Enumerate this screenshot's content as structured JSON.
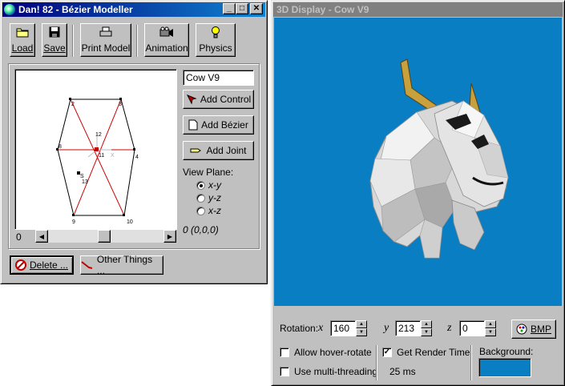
{
  "modeller": {
    "title": "Dan! 82 - Bézier Modeller",
    "caption_buttons": {
      "minimize": "_",
      "maximize": "□",
      "close": "✕"
    },
    "toolbar": [
      {
        "label": "Load",
        "icon": "folder-icon"
      },
      {
        "label": "Save",
        "icon": "floppy-icon"
      },
      {
        "label": "Print Model",
        "icon": "printer-icon"
      },
      {
        "label": "Animation",
        "icon": "camera-icon"
      },
      {
        "label": "Physics",
        "icon": "lightbulb-icon"
      }
    ],
    "canvas": {
      "point_labels": [
        "2",
        "3",
        "8",
        "4",
        "9",
        "10",
        "11",
        "12",
        "13",
        "S"
      ],
      "axis_label": "X",
      "scroll_value": "0"
    },
    "name_field": "Cow V9",
    "buttons": {
      "add_control": "Add Control",
      "add_bezier": "Add Bézier",
      "add_joint": "Add Joint",
      "delete": "Delete ...",
      "other_things": "Other Things ..."
    },
    "view_plane": {
      "label": "View Plane:",
      "options": [
        "x-y",
        "y-z",
        "x-z"
      ],
      "selected": "x-y"
    },
    "coordinate": "0 (0,0,0)"
  },
  "display": {
    "title": "3D Display - Cow V9",
    "viewport_color": "#0a7ec2",
    "rotation_label": "Rotation:",
    "axes": {
      "x": "x",
      "y": "y",
      "z": "z"
    },
    "rotation": {
      "x": "160",
      "y": "213",
      "z": "0"
    },
    "bmp_button": "BMP",
    "allow_hover_rotate": {
      "label": "Allow hover-rotate",
      "checked": false
    },
    "use_multi_threading": {
      "label": "Use multi-threading",
      "checked": false
    },
    "get_render_time": {
      "label": "Get Render Time",
      "checked": true
    },
    "render_time": "25 ms",
    "background_label": "Background:",
    "background_color": "#0a7ec2"
  }
}
